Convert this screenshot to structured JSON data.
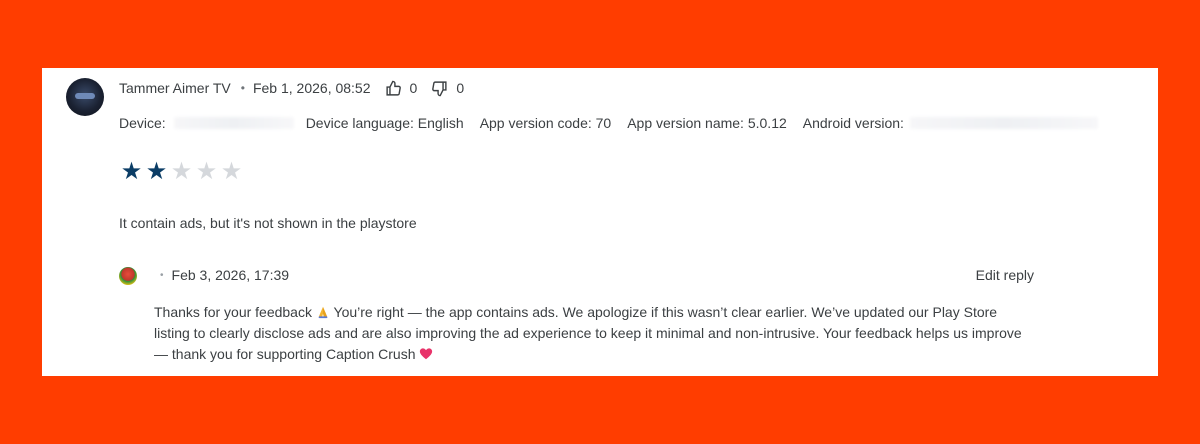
{
  "review": {
    "author": "Tammer Aimer TV",
    "date": "Feb 1, 2026, 08:52",
    "thumbs_up_count": "0",
    "thumbs_down_count": "0",
    "device_label": "Device:",
    "device_language_label": "Device language: English",
    "app_version_code_label": "App version code: 70",
    "app_version_name_label": "App version name: 5.0.12",
    "android_version_label": "Android version:",
    "rating": 2,
    "rating_max": 5,
    "text": "It contain ads, but it's not shown in the playstore"
  },
  "reply": {
    "date": "Feb 3, 2026, 17:39",
    "edit_label": "Edit reply",
    "text_part1": "Thanks for your feedback",
    "text_part2": " You’re right — the app contains ads. We apologize if this wasn’t clear earlier. We’ve updated our Play Store listing to clearly disclose ads and are also improving the ad experience to keep it minimal and non-intrusive. Your feedback helps us improve — thank you for supporting Caption Crush",
    "emoji_1": "folded-hands-icon",
    "emoji_2": "heart-icon"
  },
  "colors": {
    "background": "#ff3d00",
    "card": "#ffffff",
    "star_filled": "#0b3d66",
    "star_empty": "#d5d8dc",
    "heart": "#e8336a"
  }
}
